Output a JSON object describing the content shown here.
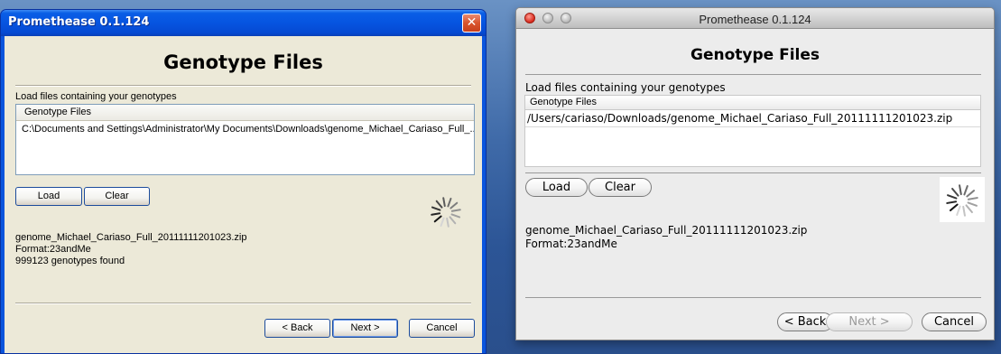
{
  "xp_window": {
    "title": "Promethease 0.1.124",
    "close_glyph": "✕",
    "heading": "Genotype Files",
    "label": "Load files containing your genotypes",
    "table": {
      "header": "Genotype Files",
      "rows": [
        "C:\\Documents and Settings\\Administrator\\My Documents\\Downloads\\genome_Michael_Cariaso_Full_..."
      ]
    },
    "buttons": {
      "load": "Load",
      "clear": "Clear",
      "back": "< Back",
      "next": "Next >",
      "cancel": "Cancel"
    },
    "info": {
      "filename": "genome_Michael_Cariaso_Full_20111111201023.zip",
      "format": "Format:23andMe",
      "count": "999123 genotypes found"
    },
    "busy_indicator": "spinner-icon"
  },
  "mac_window": {
    "title": "Promethease 0.1.124",
    "heading": "Genotype Files",
    "label": "Load files containing your genotypes",
    "table": {
      "header": "Genotype Files",
      "rows": [
        "/Users/cariaso/Downloads/genome_Michael_Cariaso_Full_20111111201023.zip"
      ]
    },
    "buttons": {
      "load": "Load",
      "clear": "Clear",
      "back": "< Back",
      "next": "Next >",
      "cancel": "Cancel",
      "next_enabled": false
    },
    "info": {
      "filename": "genome_Michael_Cariaso_Full_20111111201023.zip",
      "format": "Format:23andMe"
    },
    "busy_indicator": "spinner-icon"
  },
  "colors": {
    "desktop": "#3a66a8",
    "xp_titlebar": "#0654e0",
    "xp_client": "#ece9d8",
    "mac_client": "#ececec",
    "mac_close": "#d8281b"
  }
}
